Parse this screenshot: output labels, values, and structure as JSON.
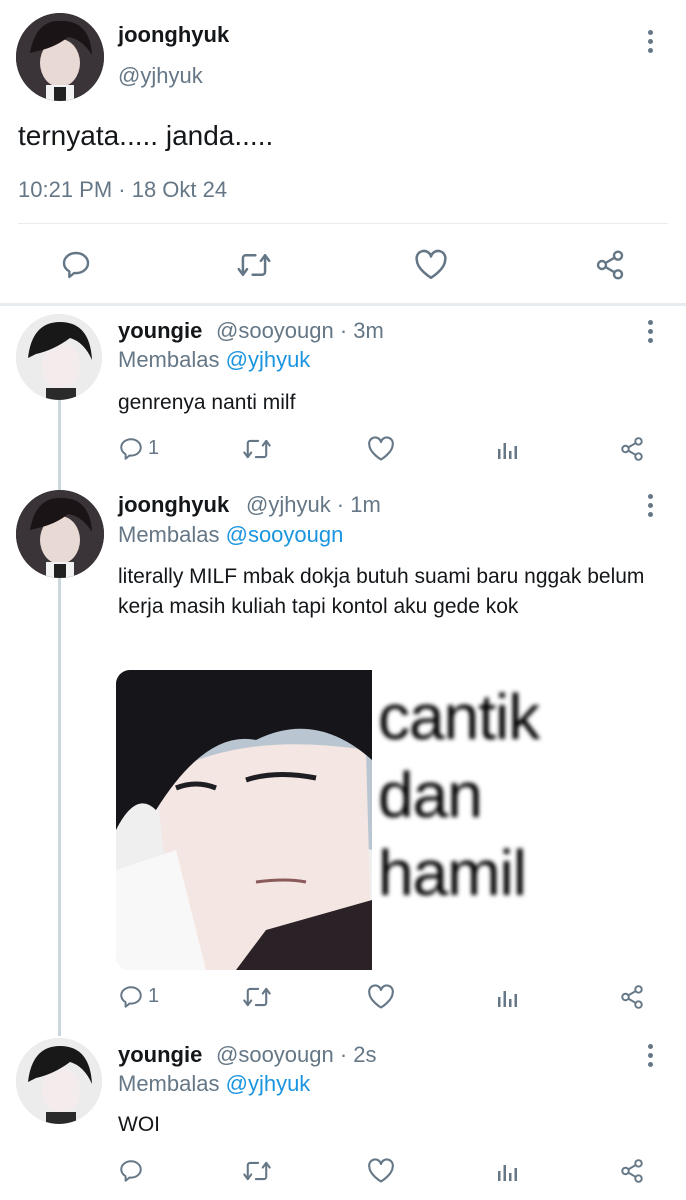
{
  "main_tweet": {
    "display_name": "joonghyuk",
    "handle": "@yjhyuk",
    "text": "ternyata..... janda.....",
    "timestamp": "10:21 PM · 18 Okt 24",
    "icons": [
      "comment-icon",
      "retweet-icon",
      "like-icon",
      "share-icon"
    ]
  },
  "replies": [
    {
      "display_name": "youngie",
      "handle_time": "@sooyougn · 3m",
      "replying_prefix": "Membalas",
      "replying_handle": "@yjhyuk",
      "text": "genrenya nanti milf",
      "reply_count": "1"
    },
    {
      "display_name": "joonghyuk",
      "handle_time": "@yjhyuk · 1m",
      "replying_prefix": "Membalas",
      "replying_handle": "@sooyougn",
      "text": "literally MILF mbak dokja butuh suami baru nggak belum kerja masih kuliah tapi kontol aku gede kok",
      "reply_count": "1",
      "media_text": [
        "cantik",
        "dan",
        "hamil"
      ]
    },
    {
      "display_name": "youngie",
      "handle_time": "@sooyougn · 2s",
      "replying_prefix": "Membalas",
      "replying_handle": "@yjhyuk",
      "text": "WOI",
      "reply_count": ""
    }
  ],
  "colors": {
    "link": "#1b95e0",
    "secondary": "#657786",
    "divider": "#e6ecf0"
  }
}
